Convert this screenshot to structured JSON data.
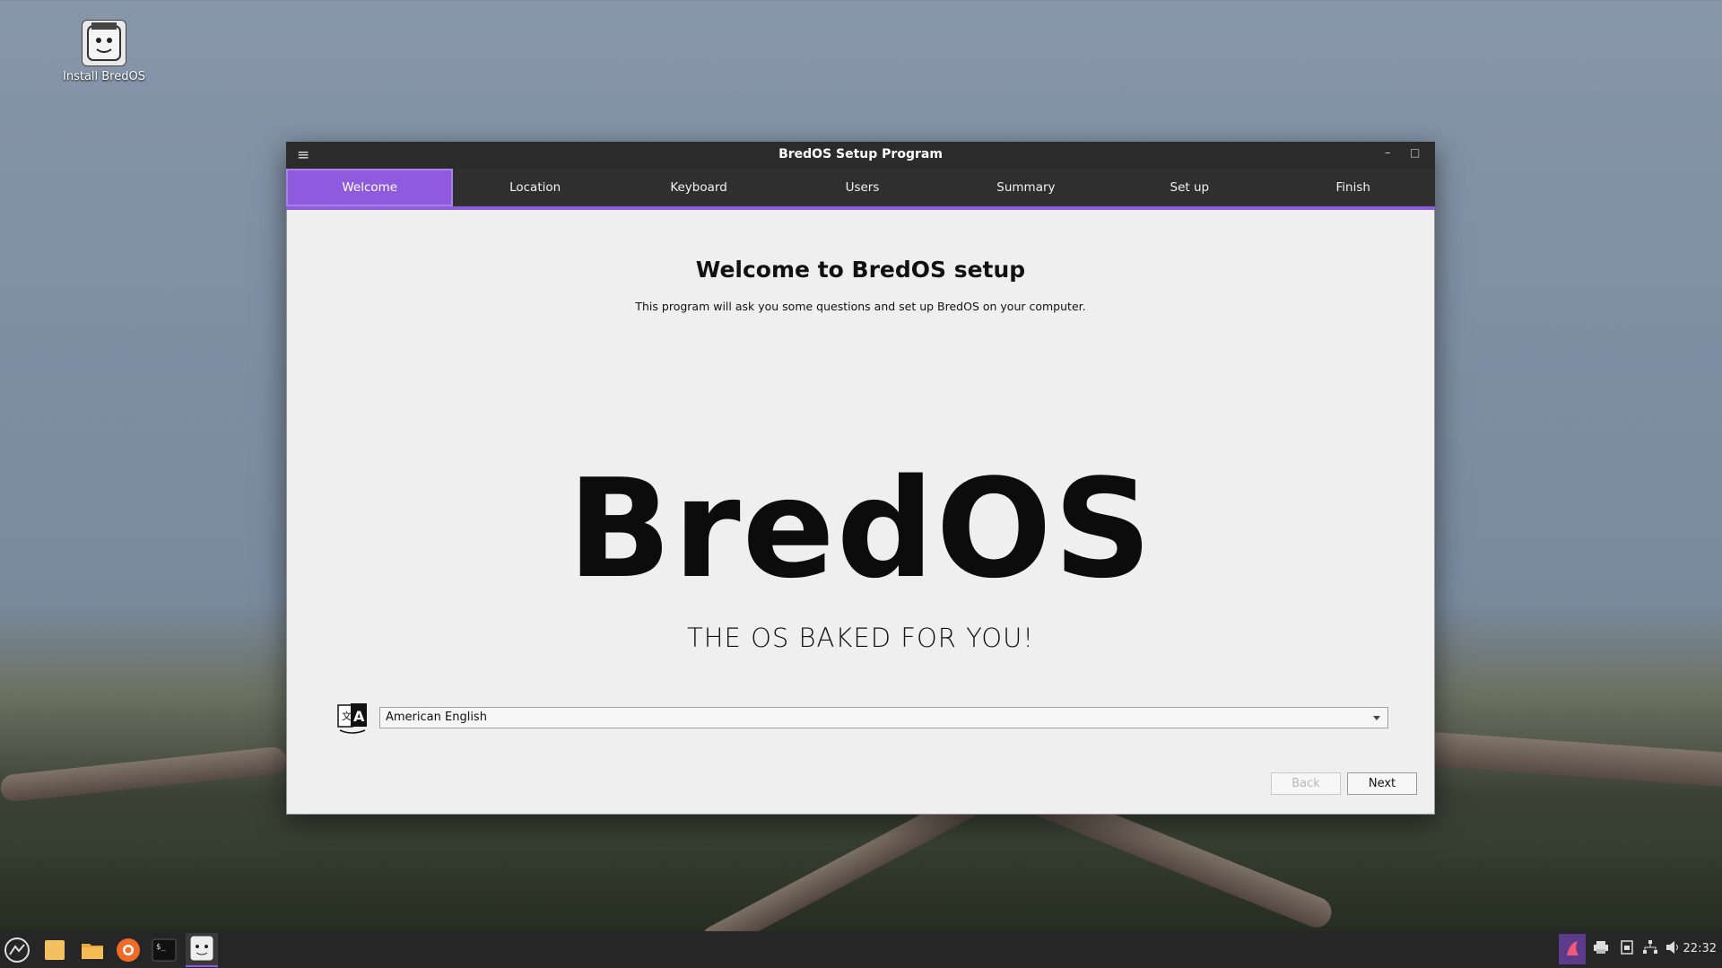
{
  "desktop": {
    "icon_label": "Install BredOS"
  },
  "window": {
    "title": "BredOS Setup Program",
    "menu_icon": "hamburger-menu-icon",
    "min_icon": "minimize-icon",
    "max_icon": "maximize-icon"
  },
  "tabs": [
    {
      "label": "Welcome",
      "active": true
    },
    {
      "label": "Location"
    },
    {
      "label": "Keyboard"
    },
    {
      "label": "Users"
    },
    {
      "label": "Summary"
    },
    {
      "label": "Set up"
    },
    {
      "label": "Finish"
    }
  ],
  "welcome": {
    "heading": "Welcome to BredOS setup",
    "subtitle": "This program will ask you some questions and set up BredOS on your computer.",
    "logo_text": "BredOS",
    "tagline": "THE OS BAKED FOR YOU!"
  },
  "language": {
    "selected": "American English",
    "icon": "language-translate-icon"
  },
  "buttons": {
    "back": "Back",
    "next": "Next"
  },
  "taskbar": {
    "clock": "22:32"
  },
  "colors": {
    "accent": "#8e5bde",
    "titlebar": "#2b2b2b",
    "content_bg": "#efefef"
  }
}
